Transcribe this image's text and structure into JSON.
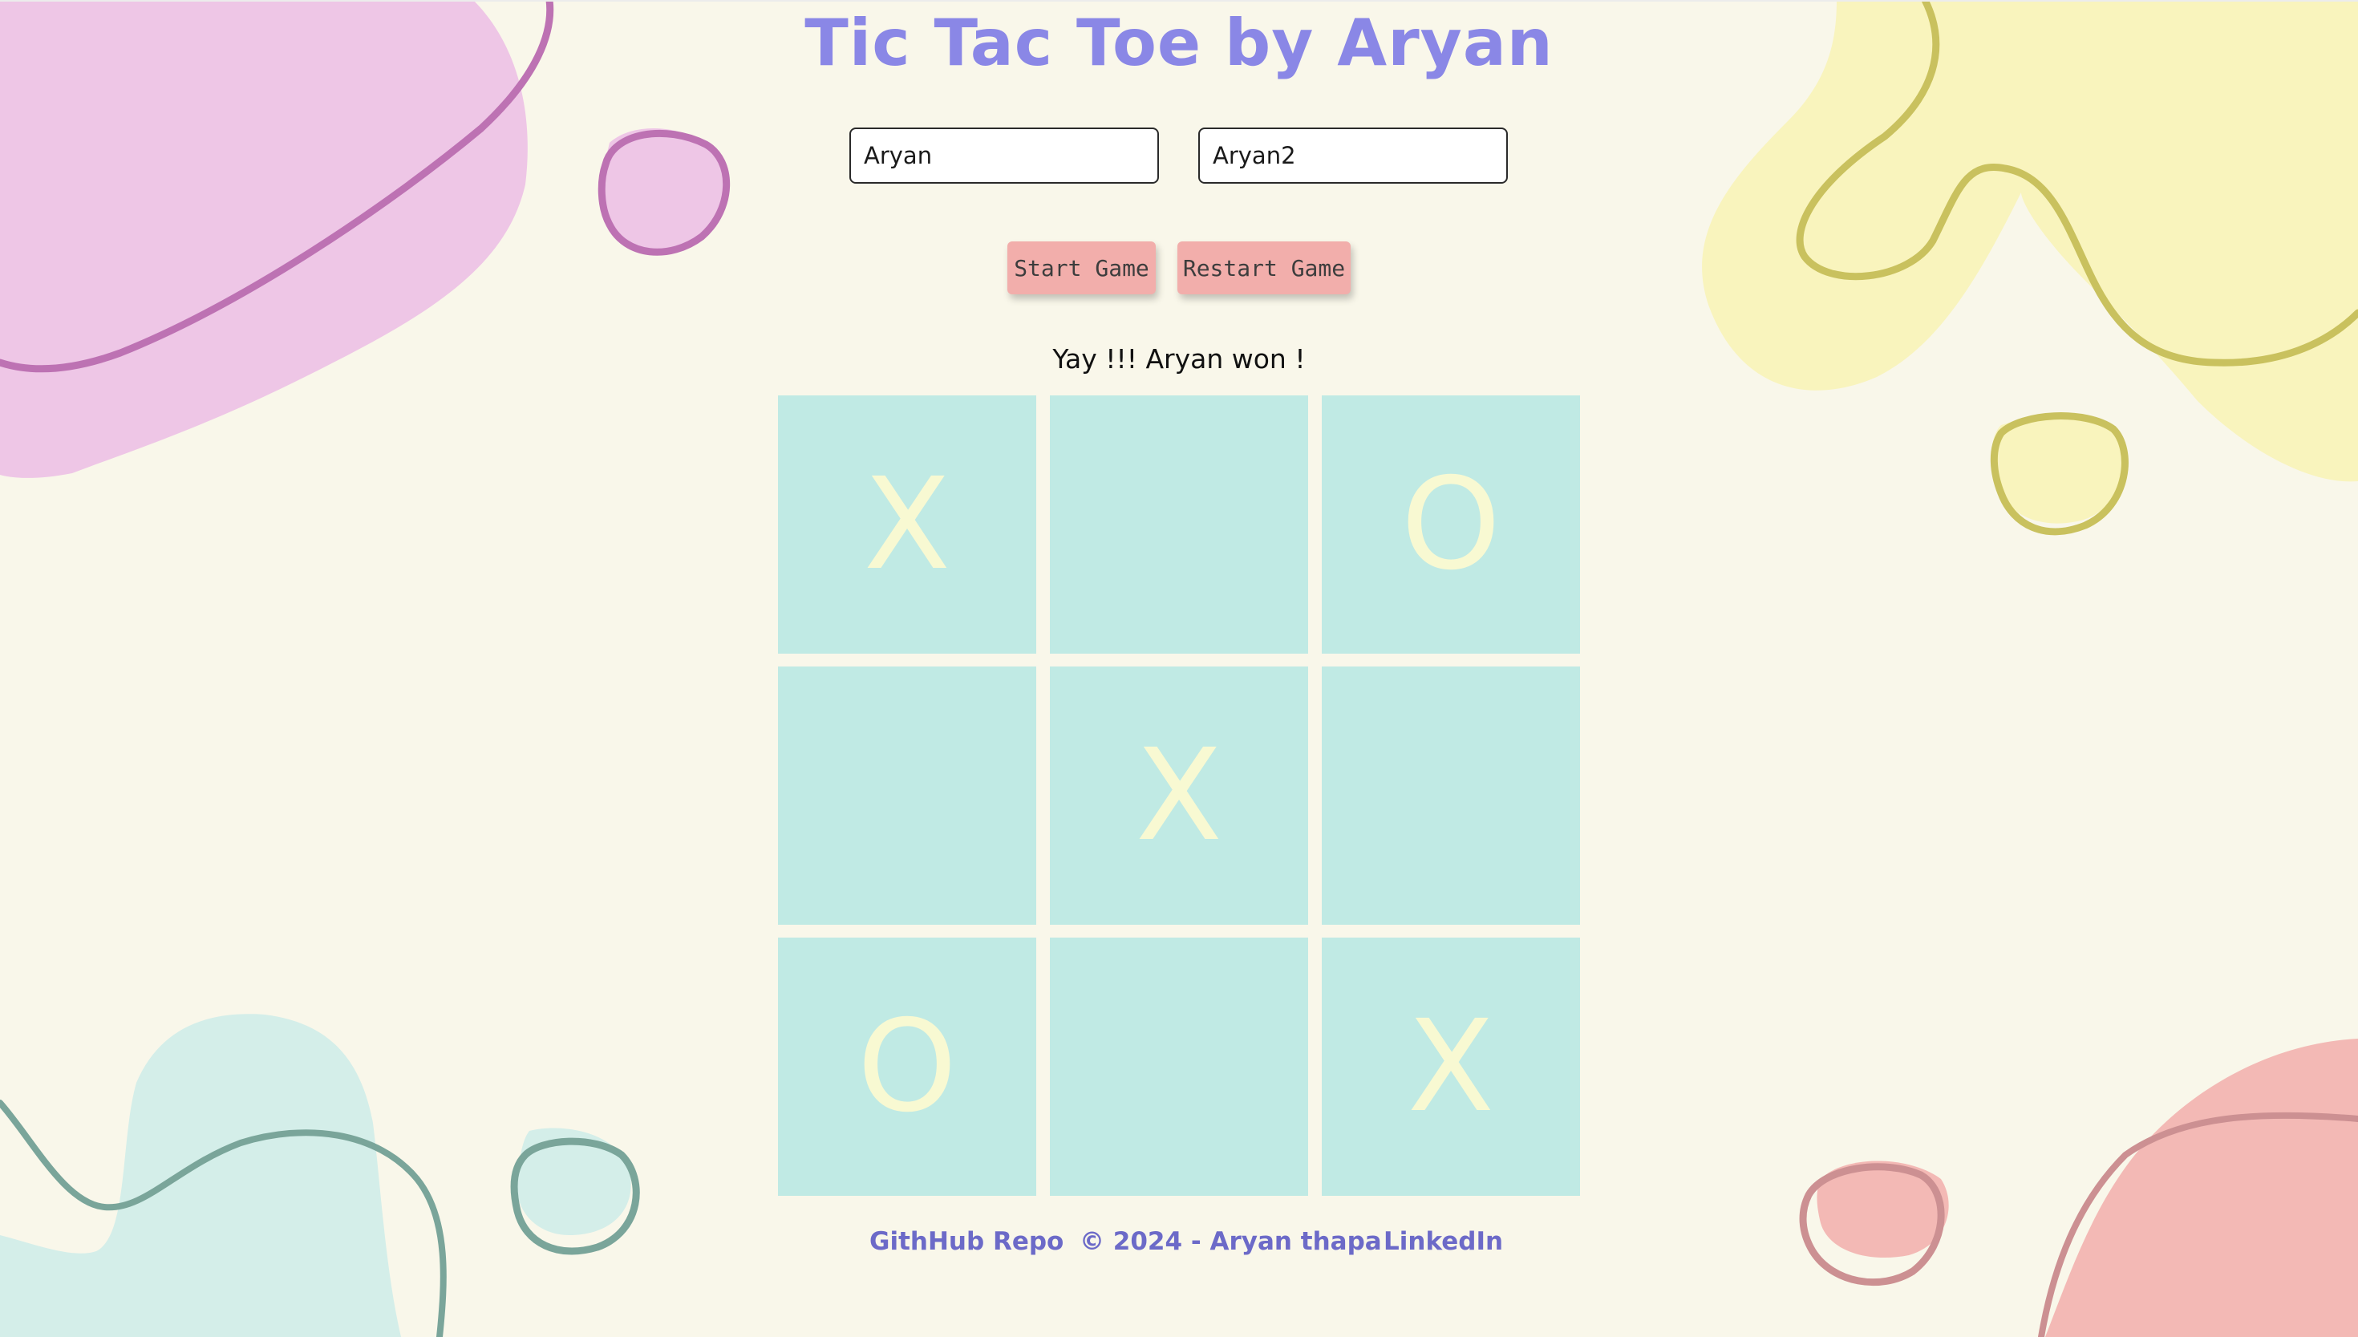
{
  "header": {
    "title": "Tic Tac Toe by Aryan"
  },
  "players": {
    "player1_value": "Aryan",
    "player2_value": "Aryan2"
  },
  "controls": {
    "start_label": "Start Game",
    "restart_label": "Restart Game"
  },
  "status": {
    "message": "Yay !!! Aryan won !"
  },
  "board": {
    "cells": [
      "X",
      "",
      "O",
      "",
      "X",
      "",
      "O",
      "",
      "X"
    ]
  },
  "footer": {
    "github_label": "GithHub Repo",
    "copyright": "© 2024 - Aryan thapa",
    "linkedin_label": "LinkedIn"
  },
  "colors": {
    "background": "#f9f7ea",
    "title": "#8a87e6",
    "cell": "#c0eae4",
    "mark": "#f8f9d2",
    "button": "#f2aeab",
    "link": "#6c6ac8"
  }
}
